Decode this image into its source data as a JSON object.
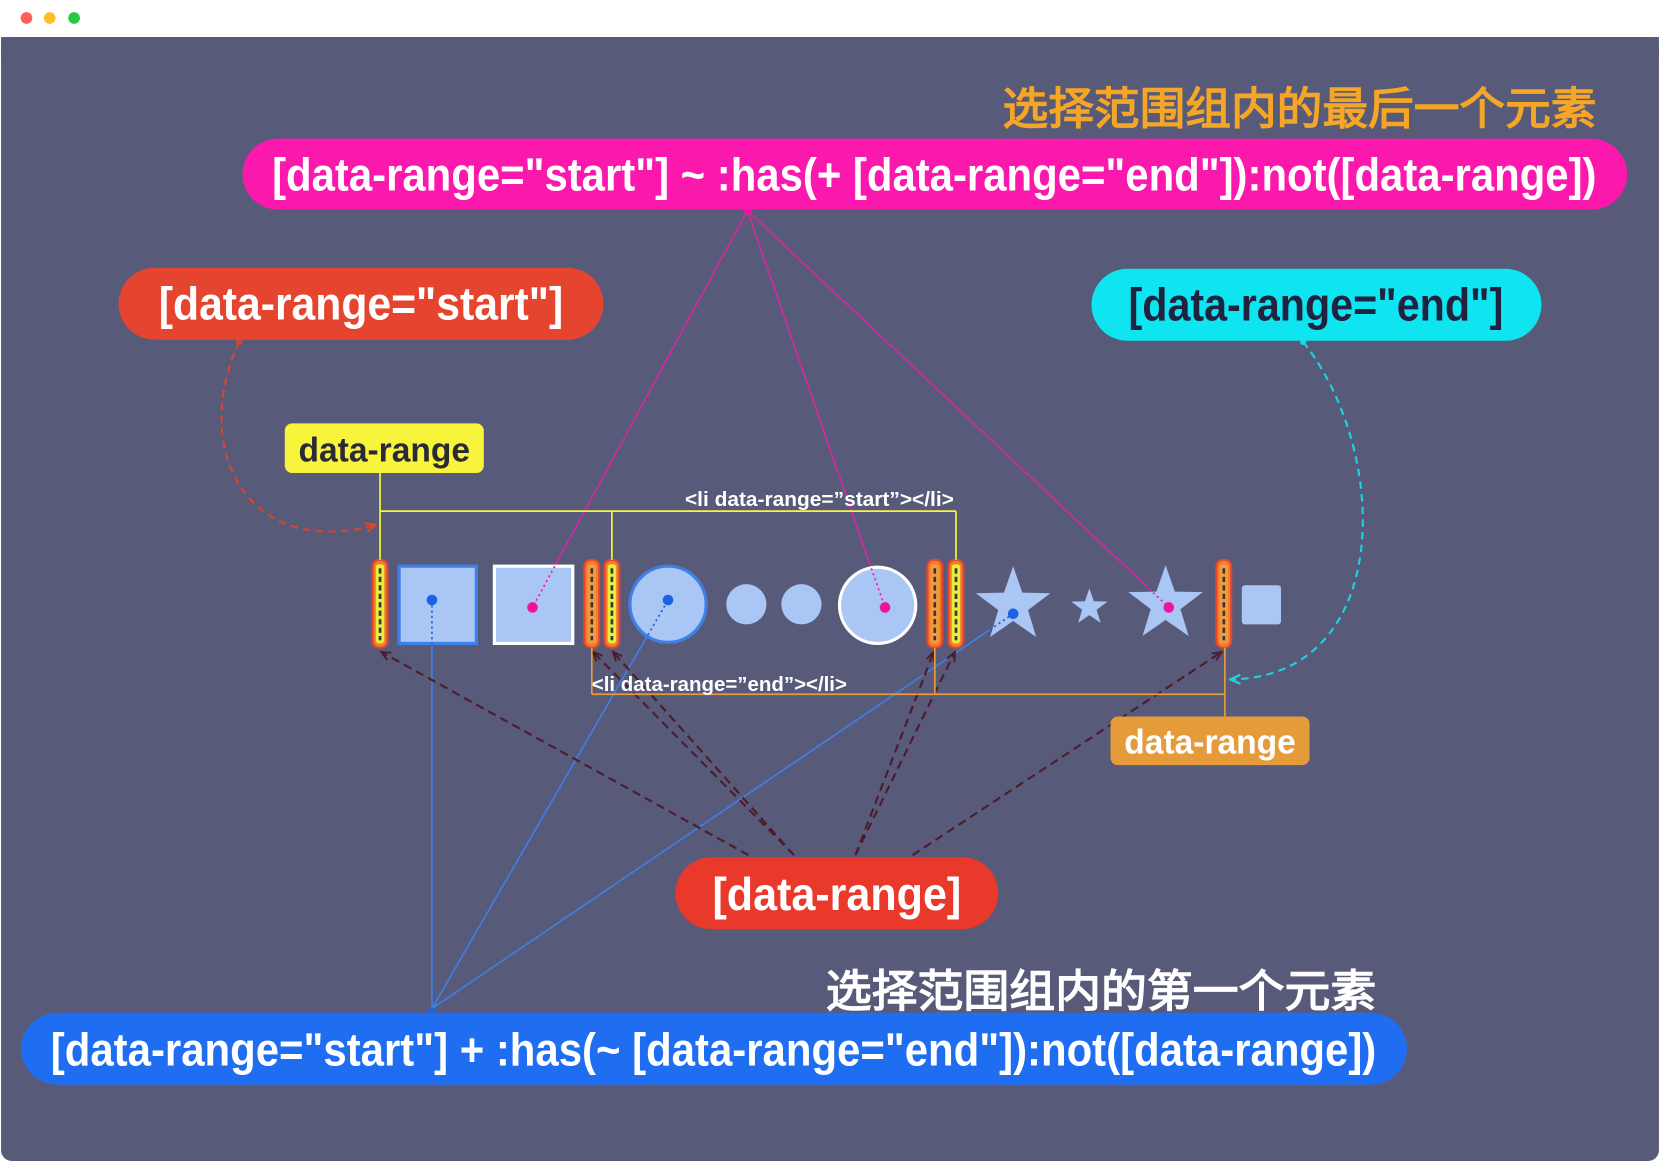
{
  "window": {
    "controls": [
      "#ff5f57",
      "#febc2e",
      "#28c840"
    ],
    "panel_color": "#585a79"
  },
  "last_in_range": {
    "title": "选择范围组内的最后一个元素",
    "selector": "[data-range=\"start\"] ~ :has(+ [data-range=\"end\"]):not([data-range])",
    "title_color": "#f6a626",
    "pill_color": "#fa18ad",
    "dot_color": "#ef149f",
    "outline_color": "#ffffff"
  },
  "first_in_range": {
    "title": "选择范围组内的第一个元素",
    "selector": "[data-range=\"start\"] + :has(~ [data-range=\"end\"]):not([data-range])",
    "title_color": "#ffffff",
    "pill_color": "#1f6ef1",
    "dot_color": "#1c63e4",
    "outline_color": "#3d80e9"
  },
  "start_marker": {
    "selector": "[data-range=\"start\"]",
    "pill_color": "#e5452f",
    "attr_label": "data-range",
    "attr_label_color": "#f8f43b",
    "markup": "<li data-range=”start”></li>",
    "marker_color": "#e6ee3c"
  },
  "end_marker": {
    "selector": "[data-range=\"end\"]",
    "pill_color": "#0fe4f1",
    "attr_label": "data-range",
    "attr_label_color": "#e69b3b",
    "markup": "<li data-range=”end”></li>",
    "marker_color": "#f39a3c"
  },
  "any_marker": {
    "selector": "[data-range]",
    "pill_color": "#e8392b"
  },
  "item_color": "#a9c6f4"
}
